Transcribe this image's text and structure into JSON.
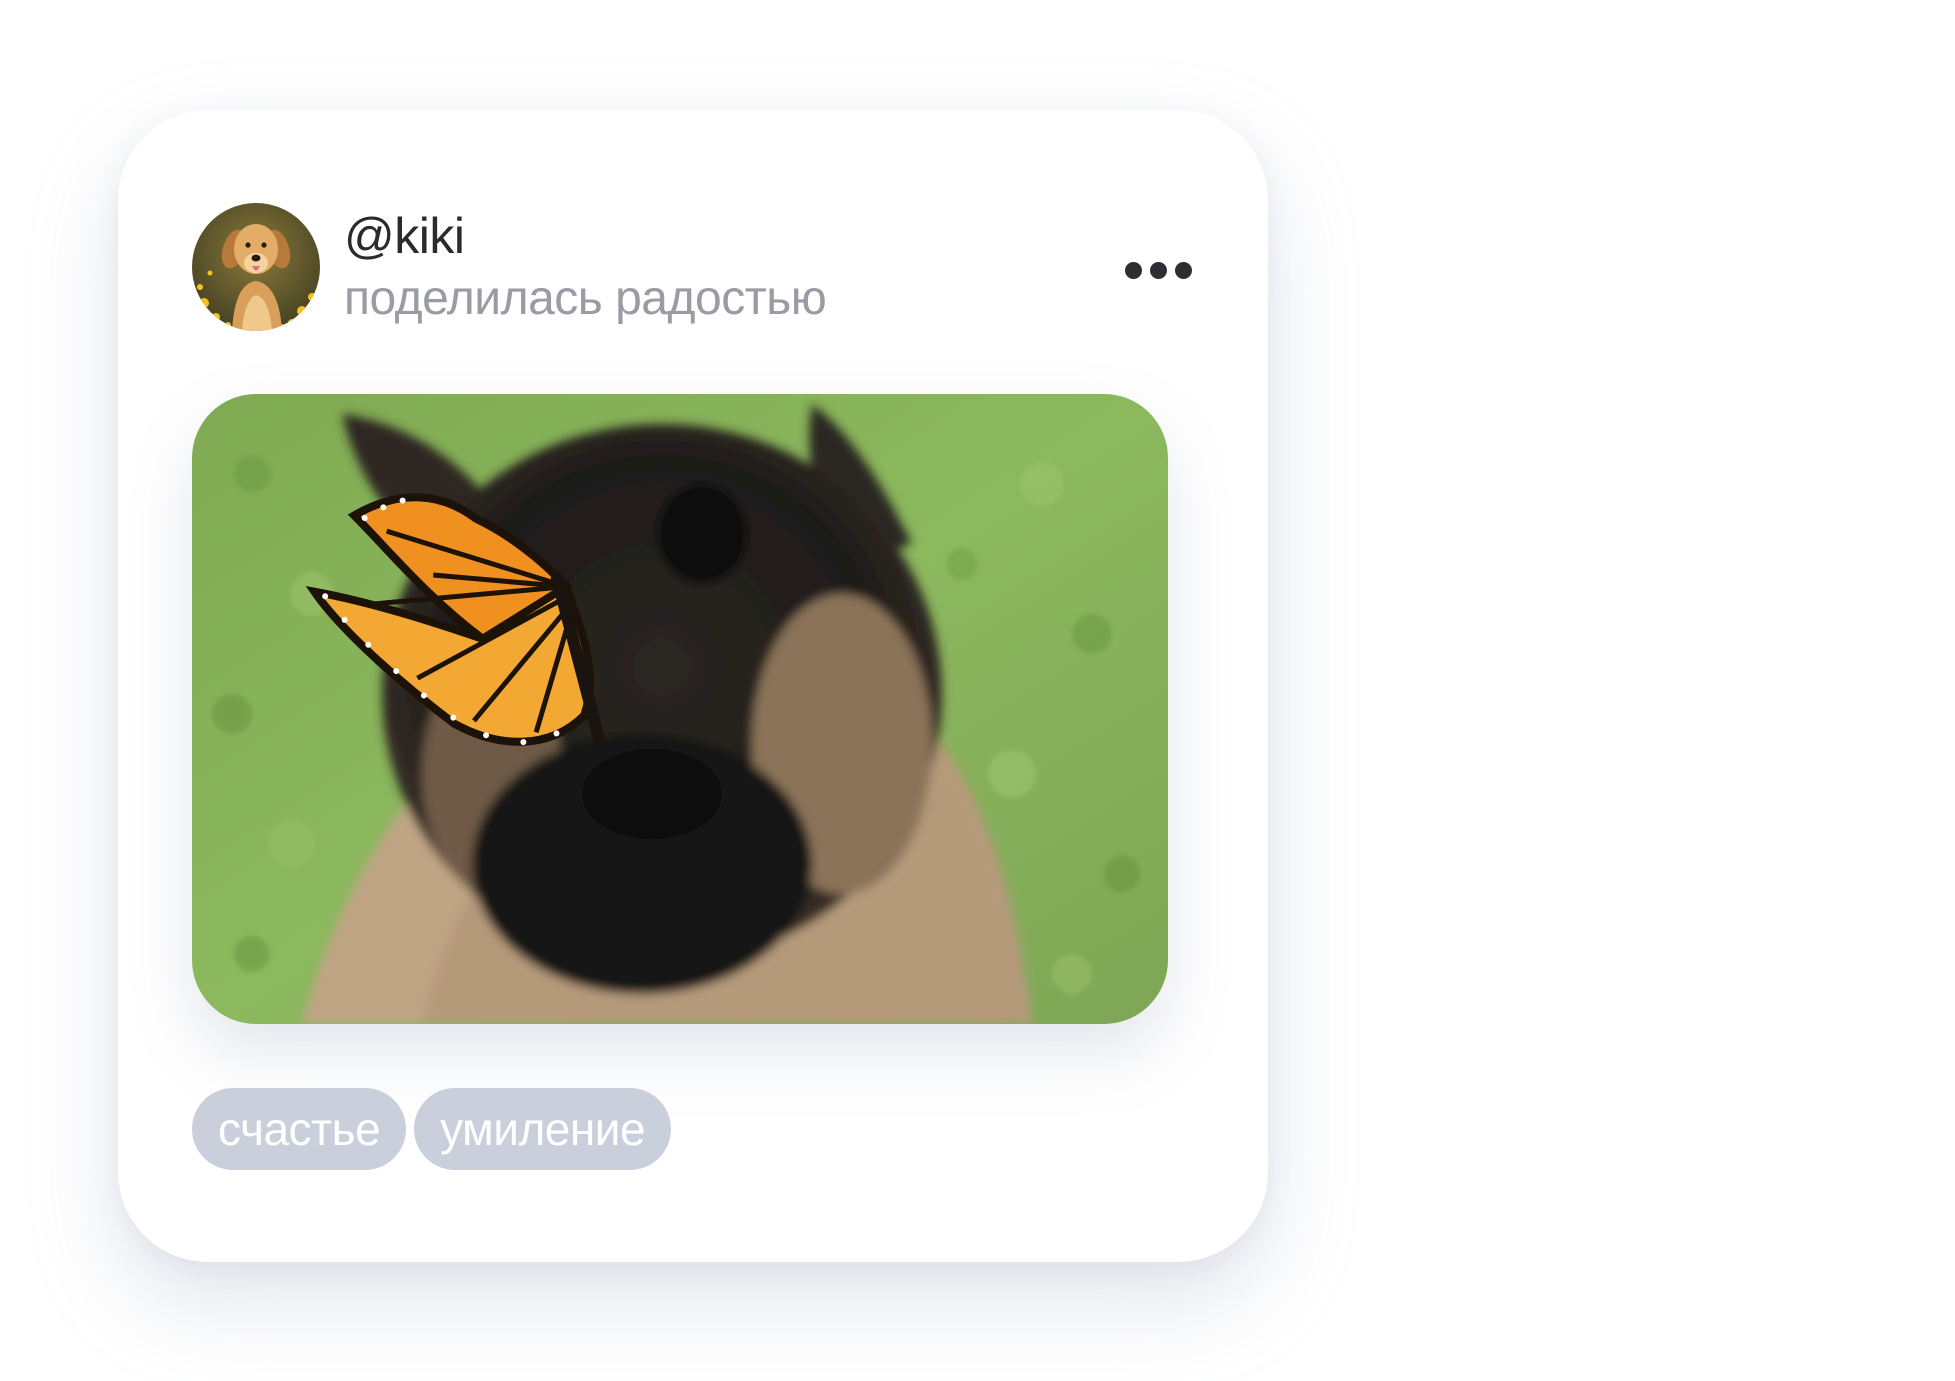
{
  "post": {
    "username": "@kiki",
    "action_text": "поделилась радостью",
    "avatar_icon": "golden-retriever-avatar",
    "more_icon": "more-dots-icon",
    "photo_description_icon": "dog-with-butterfly-photo",
    "tags": [
      {
        "label": "счастье"
      },
      {
        "label": "умиление"
      }
    ]
  },
  "colors": {
    "username": "#2b2b2f",
    "subtitle": "#9a9ba3",
    "tag_background": "#c9cfdb",
    "tag_text": "#ffffff",
    "more_dots": "#2d2d33"
  }
}
